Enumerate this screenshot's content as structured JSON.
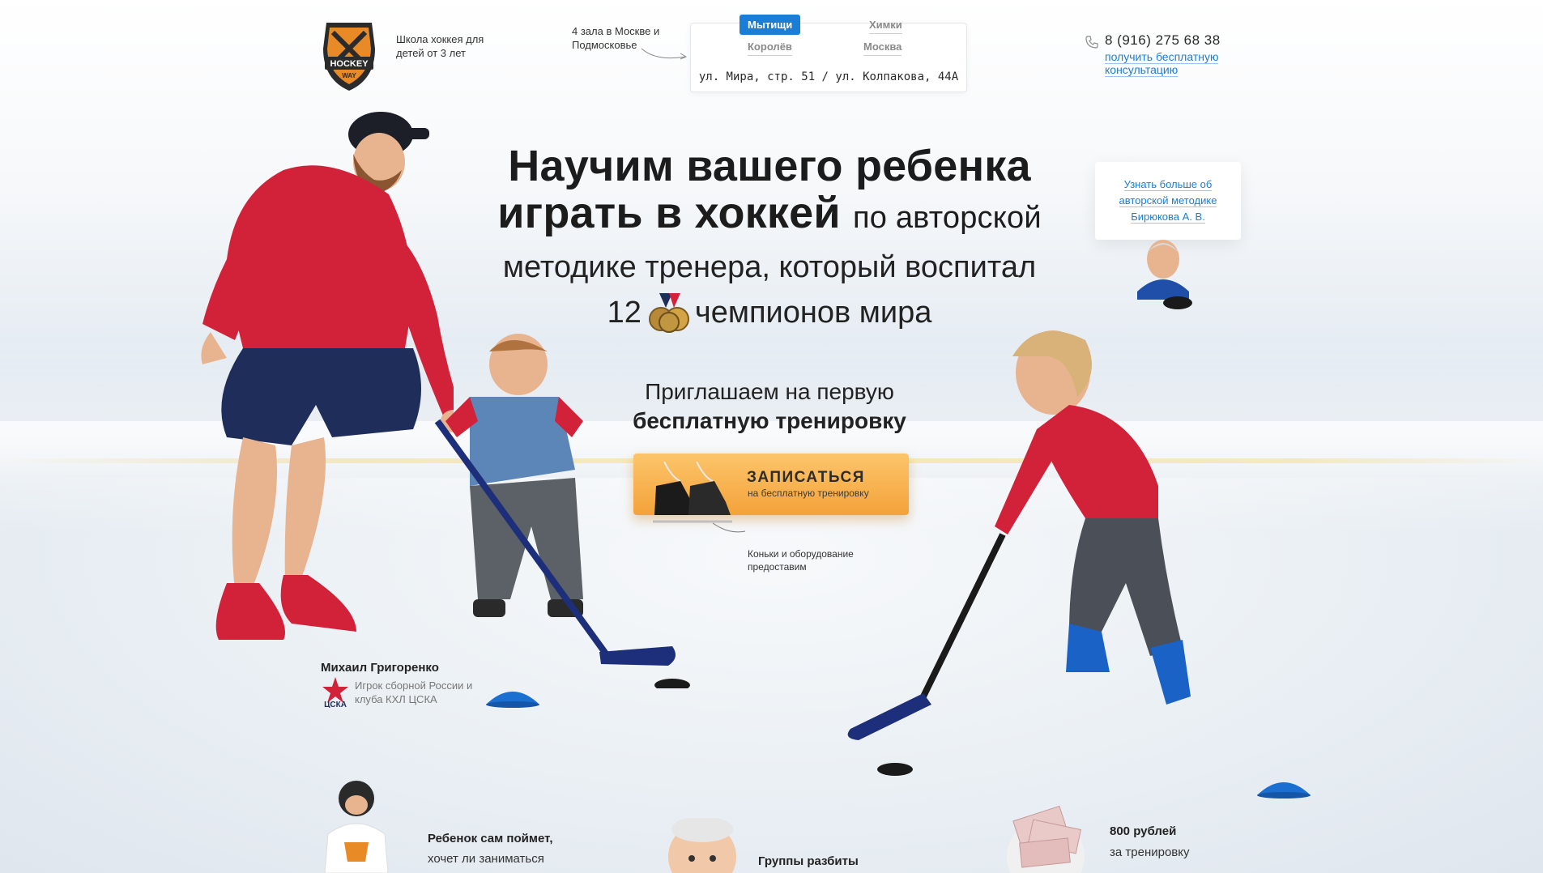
{
  "header": {
    "tagline": "Школа хоккея для детей от 3 лет",
    "halls_note": "4 зала в Москве и Подмосковье",
    "cities": [
      {
        "label": "Мытищи",
        "active": true
      },
      {
        "label": "Химки",
        "active": false
      },
      {
        "label": "Королёв",
        "active": false
      },
      {
        "label": "Москва",
        "active": false
      }
    ],
    "address": "ул. Мира, стр. 51 / ул. Колпакова, 44А",
    "phone": "8 (916) 275 68 38",
    "consult_link": "получить бесплатную консультацию"
  },
  "hero": {
    "headline_line1": "Научим вашего ребенка",
    "headline_bold2": "играть в хоккей",
    "headline_light2": "по авторской",
    "subline_line1": "методике тренера, который воспитал",
    "subline_count": "12",
    "subline_rest": "чемпионов мира",
    "invite_line1": "Приглашаем на первую",
    "invite_line2": "бесплатную тренировку",
    "cta_main": "ЗАПИСАТЬСЯ",
    "cta_sub": "на бесплатную тренировку",
    "equipment_note": "Коньки и оборудование предоставим",
    "method_link": "Узнать больше об авторской методике Бирюкова А. В."
  },
  "coach": {
    "name": "Михаил Григоренко",
    "desc": "Игрок сборной России и клуба КХЛ ЦСКА",
    "club_logo_text": "ЦСКА"
  },
  "features": [
    {
      "title": "Ребенок сам поймет,",
      "sub": "хочет ли заниматься"
    },
    {
      "title": "Группы разбиты",
      "sub": ""
    },
    {
      "title": "800 рублей",
      "sub": "за тренировку"
    }
  ],
  "colors": {
    "accent_blue": "#1a7ed6",
    "cta_orange": "#f4a23a",
    "jersey_red": "#cf2136"
  }
}
